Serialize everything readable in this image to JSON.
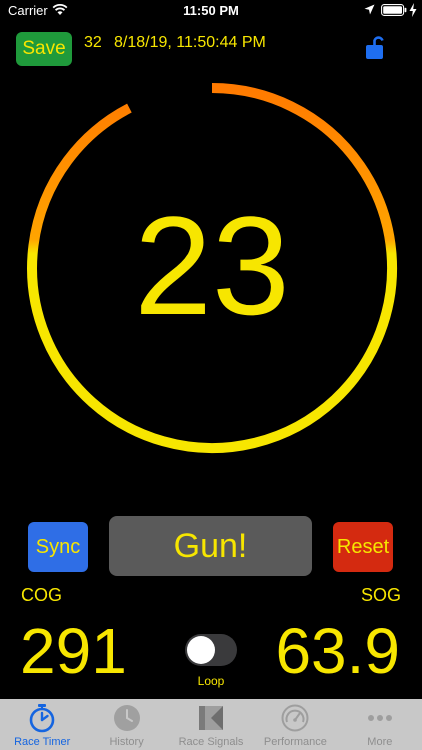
{
  "status_bar": {
    "carrier": "Carrier",
    "time": "11:50 PM"
  },
  "header": {
    "save_label": "Save",
    "race_number": "32",
    "race_datetime": "8/18/19, 11:50:44 PM"
  },
  "timer": {
    "countdown": "23",
    "ring_colors": {
      "start": "#ff7a00",
      "end": "#f7e600"
    }
  },
  "controls": {
    "sync_label": "Sync",
    "gun_label": "Gun!",
    "reset_label": "Reset"
  },
  "readouts": {
    "cog_label": "COG",
    "cog_value": "291",
    "sog_label": "SOG",
    "sog_value": "63.9",
    "loop_label": "Loop",
    "loop_on": false
  },
  "tab_bar": {
    "tabs": [
      {
        "label": "Race Timer",
        "icon": "stopwatch-icon",
        "active": true
      },
      {
        "label": "History",
        "icon": "clock-icon",
        "active": false
      },
      {
        "label": "Race Signals",
        "icon": "flag-icon",
        "active": false
      },
      {
        "label": "Performance",
        "icon": "speedometer-icon",
        "active": false
      },
      {
        "label": "More",
        "icon": "more-icon",
        "active": false
      }
    ]
  },
  "colors": {
    "accent_yellow": "#f7e600",
    "save_green": "#1f9a3b",
    "sync_blue": "#2f6ee6",
    "reset_red": "#d42a10",
    "tab_active_blue": "#1565e0"
  }
}
